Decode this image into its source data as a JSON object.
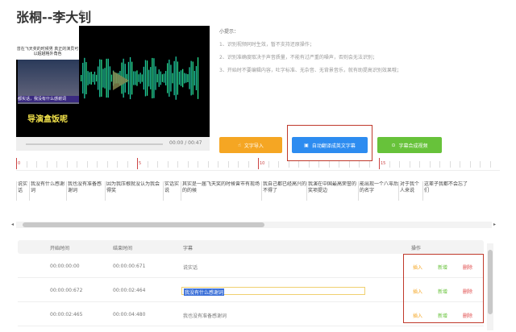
{
  "header": {
    "title": "张桐--李大钊",
    "edit_icon": "pencil-icon"
  },
  "video": {
    "thumb_top_text": "曾在飞天奖的时候男 真正的演员可以超越格外角色",
    "thumb_caption": "都实话，我没有什么感谢词",
    "thumb_big_text": "导演盒饭呢",
    "time": "00:00 / 00:47"
  },
  "tips": {
    "heading": "小提示：",
    "items": [
      "1、识别视频同时生效，暂不支持还原操作；",
      "2、识别准确度取决于声音质量，不能有过严重的噪声，否则会无法识别；",
      "3、开始时不要编辑内容，吐字标准、无杂音、无背景音乐，就有助提高识别效果哦；"
    ]
  },
  "buttons": {
    "text_import": "文字导入",
    "auto_translate": "自动翻译成英文字幕",
    "generate": "字幕合成视频"
  },
  "colors": {
    "orange": "#f5a623",
    "blue": "#2d8cf0",
    "green": "#67c23a",
    "red": "#e04a4a",
    "highlight": "#c0392b"
  },
  "ruler": {
    "labels": [
      "0",
      "5",
      "10",
      "15",
      "20"
    ]
  },
  "segments": [
    "说实话",
    "我没有什么感谢词",
    "我也没有准备感谢词",
    "因为我压根就没认为我会得奖",
    "实话实说",
    "其实是一届飞天奖的时候曾市有现场的的候",
    "我自己都已经高兴的不得了",
    "我演在中国最高荣誉的奖项提边",
    "能出现一个八零后的名字",
    "对于我个人来说",
    "这辈子我都不会忘了们"
  ],
  "table": {
    "headers": [
      "开始时间",
      "结束时间",
      "字幕",
      "操作"
    ],
    "rows": [
      {
        "start": "00:00:00:00",
        "end": "00:00:00:671",
        "text": "说实话"
      },
      {
        "start": "00:00:00:672",
        "end": "00:00:02:464",
        "text": "我没有什么感谢词"
      },
      {
        "start": "00:00:02:465",
        "end": "00:00:04:480",
        "text": "我也没有准备感谢词"
      }
    ],
    "ops": [
      "插入",
      "新增",
      "删除"
    ]
  }
}
